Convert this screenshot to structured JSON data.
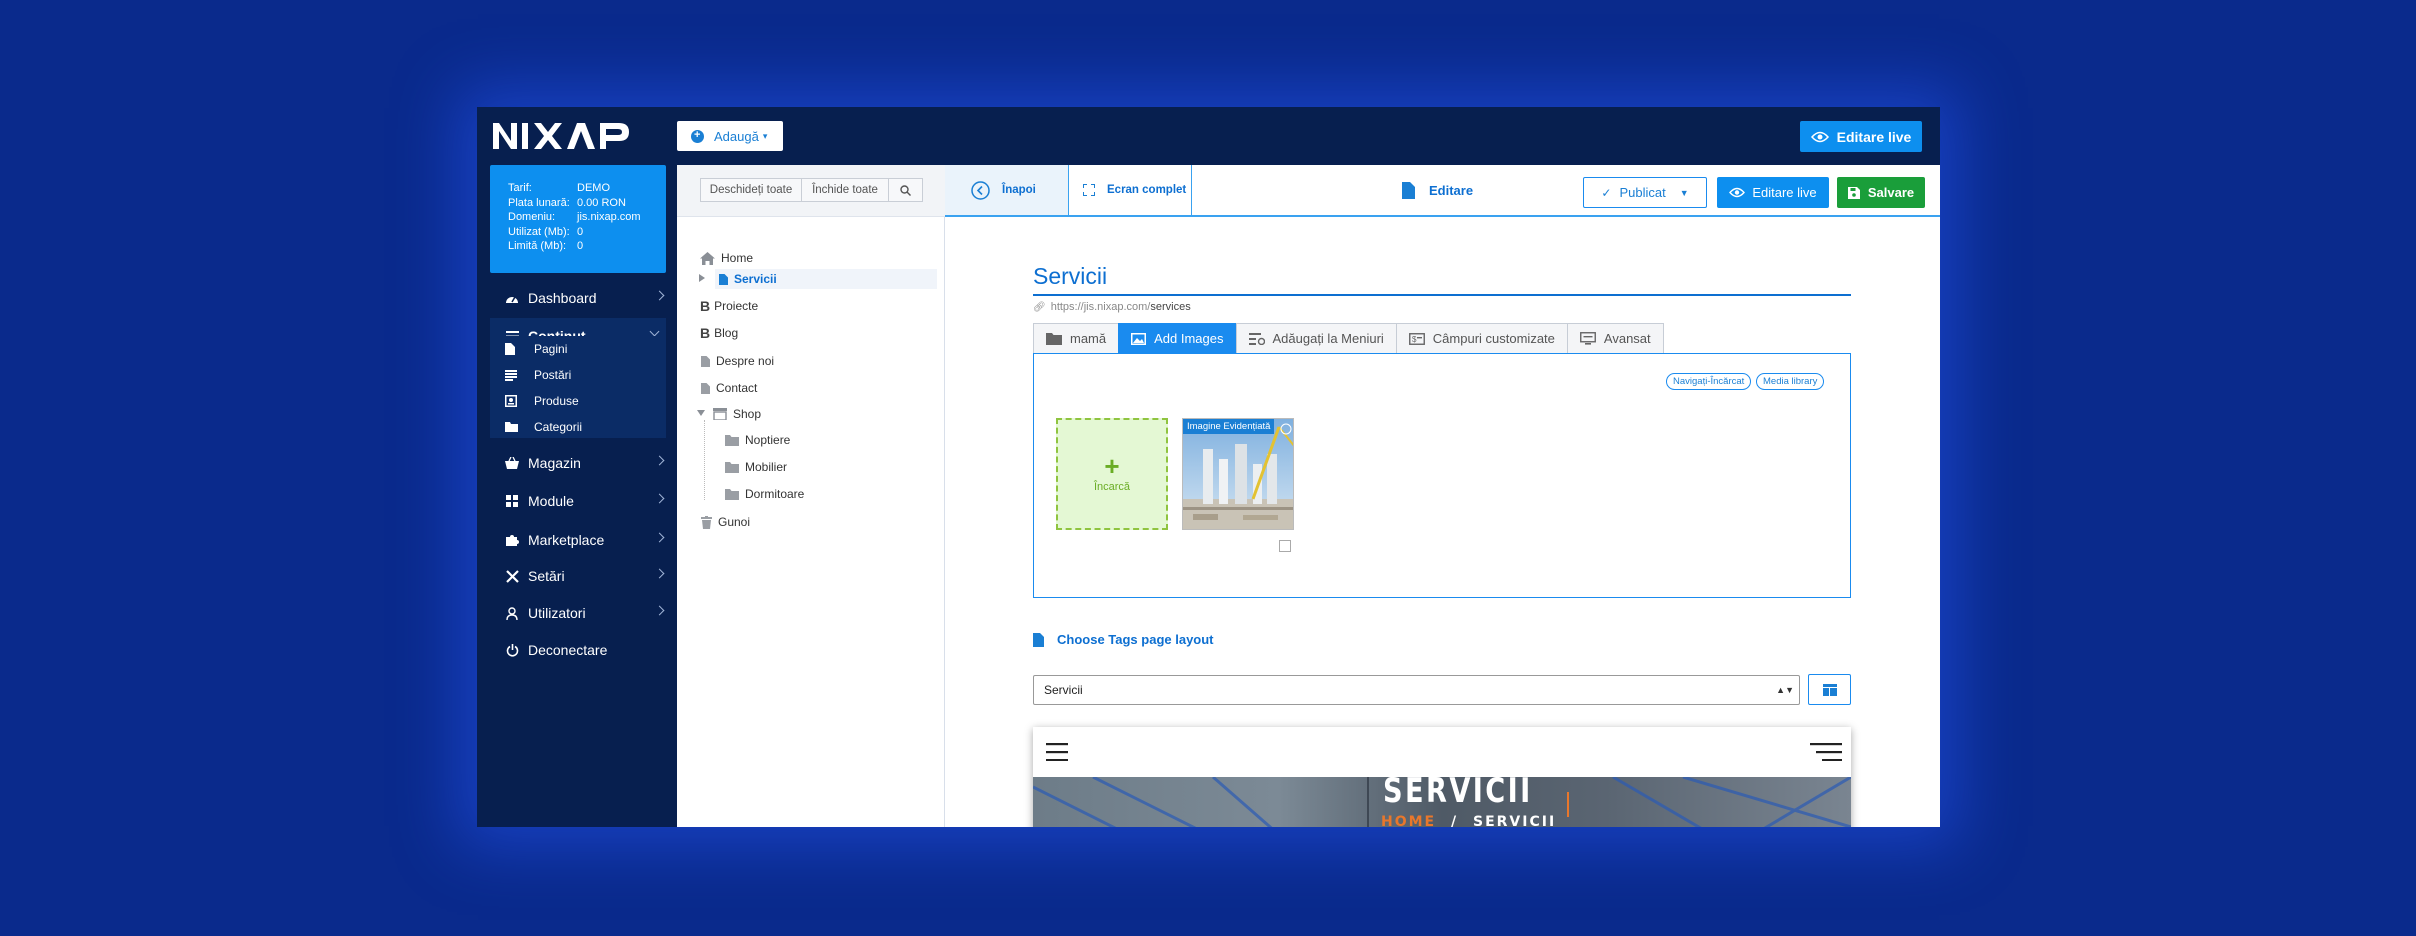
{
  "topbar": {
    "logo_text": "NIXAP",
    "add_label": "Adaugă",
    "live_edit_label": "Editare live"
  },
  "plan": {
    "rows": [
      {
        "key": "Tarif:",
        "value": "DEMO"
      },
      {
        "key": "Plata lunară:",
        "value": "0.00 RON"
      },
      {
        "key": "Domeniu:",
        "value": "jis.nixap.com"
      },
      {
        "key": "Utilizat (Mb):",
        "value": "0"
      },
      {
        "key": "Limită (Mb):",
        "value": "0"
      }
    ]
  },
  "sidebar": {
    "items": [
      {
        "label": "Dashboard",
        "icon": "gauge-icon"
      },
      {
        "label": "Conținut",
        "icon": "list-icon"
      },
      {
        "label": "Magazin",
        "icon": "basket-icon"
      },
      {
        "label": "Module",
        "icon": "grid-icon"
      },
      {
        "label": "Marketplace",
        "icon": "puzzle-icon"
      },
      {
        "label": "Setări",
        "icon": "tools-icon"
      },
      {
        "label": "Utilizatori",
        "icon": "user-icon"
      },
      {
        "label": "Deconectare",
        "icon": "power-icon"
      }
    ],
    "subitems": [
      {
        "label": "Pagini",
        "icon": "page-icon"
      },
      {
        "label": "Postări",
        "icon": "posts-icon"
      },
      {
        "label": "Produse",
        "icon": "product-icon"
      },
      {
        "label": "Categorii",
        "icon": "folder-icon"
      }
    ]
  },
  "tree": {
    "open_all_label": "Deschideți toate",
    "close_all_label": "Închide toate",
    "nodes": [
      "Home",
      "Servicii",
      "Proiecte",
      "Blog",
      "Despre noi",
      "Contact",
      "Shop",
      "Noptiere",
      "Mobilier",
      "Dormitoare",
      "Gunoi"
    ]
  },
  "editbar": {
    "back_label": "Înapoi",
    "fullscreen_label": "Ecran complet",
    "edit_label": "Editare",
    "published_label": "Publicat",
    "live_edit_label": "Editare live",
    "save_label": "Salvare"
  },
  "page": {
    "title": "Servicii",
    "url_prefix": "https://jis.nixap.com/",
    "url_slug": "services",
    "tabs": [
      {
        "label": "mamă",
        "icon": "folder-icon"
      },
      {
        "label": "Add Images",
        "icon": "image-icon"
      },
      {
        "label": "Adăugați la Meniuri",
        "icon": "menu-add-icon"
      },
      {
        "label": "Câmpuri customizate",
        "icon": "custom-fields-icon"
      },
      {
        "label": "Avansat",
        "icon": "monitor-icon"
      }
    ],
    "browse_upload_label": "Navigați-Încărcat",
    "media_library_label": "Media library",
    "upload_label": "Încarcă",
    "featured_image_label": "Imagine Evidențiată",
    "tags_layout_label": "Choose Tags page layout",
    "layout_select_value": "Servicii",
    "preview_title": "SERVICII",
    "preview_crumb_home": "HOME",
    "preview_crumb_sep": "/",
    "preview_crumb_current": "SERVICII"
  },
  "colors": {
    "background": "#0a2a8c",
    "navy": "#071f4f",
    "accent": "#0d8fef",
    "save_green": "#1a9e3a"
  }
}
